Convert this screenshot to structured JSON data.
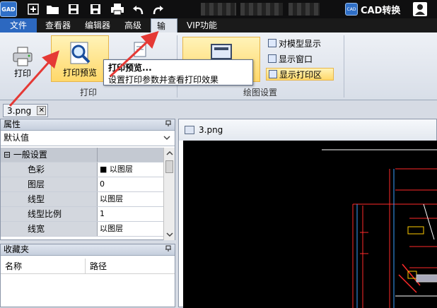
{
  "titlebar": {
    "logo_text": "GAD",
    "cad_convert_label": "CAD转换",
    "icons": [
      "new-file-icon",
      "open-folder-icon",
      "save-icon",
      "save-as-icon",
      "print-icon",
      "undo-icon",
      "redo-icon"
    ]
  },
  "menu": {
    "file": "文件",
    "viewer": "查看器",
    "editor": "编辑器",
    "advanced": "高级",
    "output": "输出",
    "vip": "VIP功能"
  },
  "ribbon": {
    "print_button": "打印",
    "print_preview_button": "打印预览",
    "print_group_label": "打印",
    "draw_settings_label": "绘图设置",
    "options": {
      "show_model": "对模型显示",
      "show_window": "显示窗口",
      "show_print_area": "显示打印区"
    }
  },
  "tooltip": {
    "title": "打印预览...",
    "description": "设置打印参数并查看打印效果"
  },
  "file_tab": {
    "name": "3.png",
    "close": "✕"
  },
  "properties": {
    "header": "属性",
    "pin": "ᅟ",
    "dropdown_value": "默认值",
    "group": "一般设置",
    "group_toggle": "⊟",
    "rows": [
      {
        "name": "色彩",
        "value": "■ 以图层"
      },
      {
        "name": "图层",
        "value": "0"
      },
      {
        "name": "线型",
        "value": "以图层"
      },
      {
        "name": "线型比例",
        "value": "1"
      },
      {
        "name": "线宽",
        "value": "以图层"
      }
    ]
  },
  "favorites": {
    "header": "收藏夹",
    "col_name": "名称",
    "col_path": "路径"
  },
  "document": {
    "title": "3.png"
  },
  "colors": {
    "accent_blue": "#2c68c0",
    "highlight": "#ffd86a",
    "arrow_red": "#e53935"
  }
}
